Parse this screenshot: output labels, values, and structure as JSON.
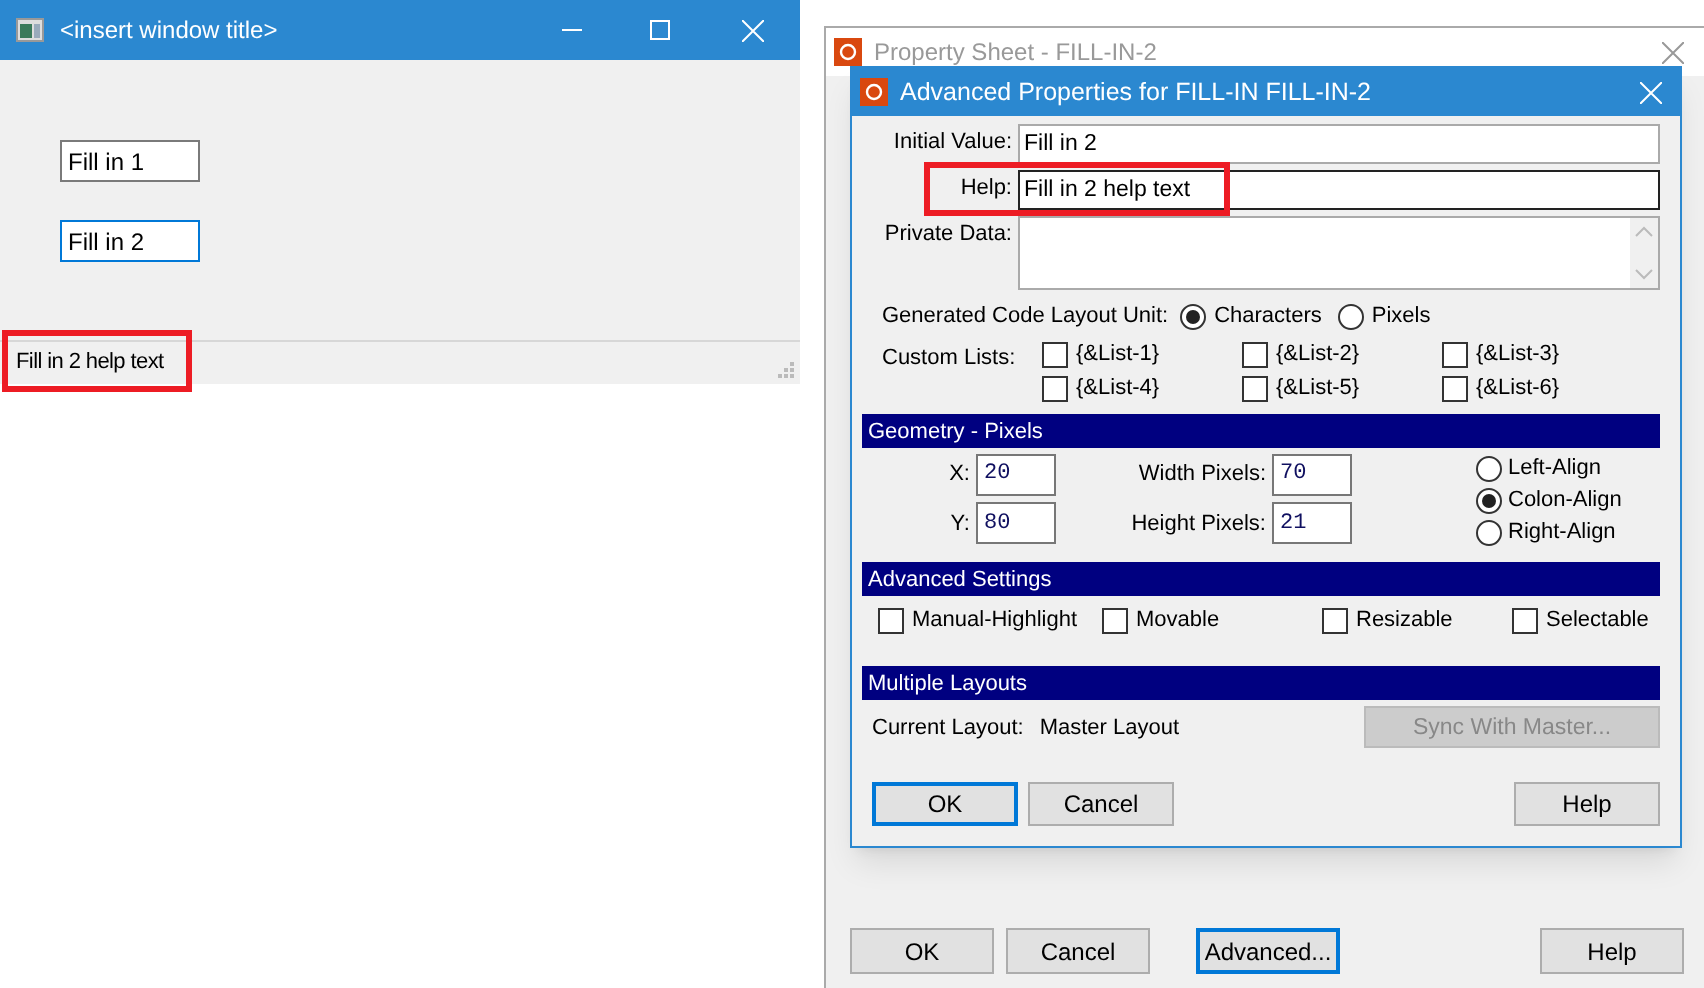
{
  "app_window": {
    "title": "<insert window title>",
    "fields": [
      {
        "value": "Fill in 1",
        "focused": false
      },
      {
        "value": "Fill in 2",
        "focused": true
      }
    ],
    "status_text": "Fill in 2 help text"
  },
  "property_sheet": {
    "title": "Property Sheet - FILL-IN-2",
    "buttons": [
      {
        "label": "OK",
        "focused": false
      },
      {
        "label": "Cancel",
        "focused": false
      },
      {
        "label": "Advanced...",
        "focused": true
      },
      {
        "label": "Help",
        "focused": false
      }
    ]
  },
  "dialog": {
    "title": "Advanced Properties for FILL-IN FILL-IN-2",
    "initial_value": {
      "label": "Initial Value:",
      "value": "Fill in 2"
    },
    "help": {
      "label": "Help:",
      "value": "Fill in 2 help text"
    },
    "private_data": {
      "label": "Private Data:"
    },
    "layout_unit": {
      "label": "Generated Code Layout Unit:",
      "options": [
        {
          "label": "Characters",
          "selected": true
        },
        {
          "label": "Pixels",
          "selected": false
        }
      ]
    },
    "custom_lists": {
      "label": "Custom Lists:",
      "items": [
        {
          "label": "{&List-1}",
          "checked": false
        },
        {
          "label": "{&List-2}",
          "checked": false
        },
        {
          "label": "{&List-3}",
          "checked": false
        },
        {
          "label": "{&List-4}",
          "checked": false
        },
        {
          "label": "{&List-5}",
          "checked": false
        },
        {
          "label": "{&List-6}",
          "checked": false
        }
      ]
    },
    "geometry": {
      "heading": "Geometry - Pixels",
      "fields": [
        {
          "label": "X:",
          "value": "20"
        },
        {
          "label": "Width Pixels:",
          "value": "70"
        },
        {
          "label": "Y:",
          "value": "80"
        },
        {
          "label": "Height Pixels:",
          "value": "21"
        }
      ],
      "alignment": [
        {
          "label": "Left-Align",
          "selected": false
        },
        {
          "label": "Colon-Align",
          "selected": true
        },
        {
          "label": "Right-Align",
          "selected": false
        }
      ]
    },
    "advanced_settings": {
      "heading": "Advanced Settings",
      "options": [
        {
          "label": "Manual-Highlight",
          "checked": false
        },
        {
          "label": "Movable",
          "checked": false
        },
        {
          "label": "Resizable",
          "checked": false
        },
        {
          "label": "Selectable",
          "checked": false
        }
      ]
    },
    "multiple_layouts": {
      "heading": "Multiple Layouts",
      "current_label": "Current Layout:",
      "current_value": "Master Layout",
      "sync_button": {
        "label": "Sync With Master...",
        "disabled": true
      }
    },
    "buttons": [
      {
        "label": "OK",
        "focused": true
      },
      {
        "label": "Cancel",
        "focused": false
      },
      {
        "label": "Help",
        "focused": false
      }
    ]
  }
}
